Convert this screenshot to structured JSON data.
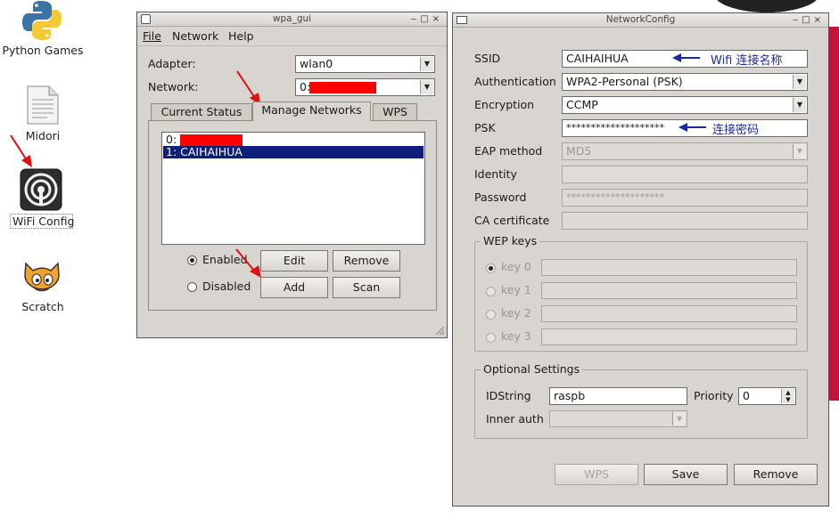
{
  "desktop": {
    "icons": [
      {
        "label": "Python Games",
        "icon": "python-icon"
      },
      {
        "label": "Midori",
        "icon": "document-icon"
      },
      {
        "label": "WiFi Config",
        "icon": "wifi-icon"
      },
      {
        "label": "Scratch",
        "icon": "scratch-cat-icon"
      }
    ]
  },
  "wpa_gui": {
    "title": "wpa_gui",
    "menu": [
      "File",
      "Network",
      "Help"
    ],
    "adapter_label": "Adapter:",
    "adapter_value": "wlan0",
    "network_label": "Network:",
    "network_value": "0:",
    "tabs": [
      "Current Status",
      "Manage Networks",
      "WPS"
    ],
    "networks": [
      "0:",
      "1: CAIHAIHUA"
    ],
    "enabled_label": "Enabled",
    "disabled_label": "Disabled",
    "edit_label": "Edit",
    "remove_label": "Remove",
    "add_label": "Add",
    "scan_label": "Scan"
  },
  "netconfig": {
    "title": "NetworkConfig",
    "ssid_label": "SSID",
    "ssid_value": "CAIHAIHUA",
    "ssid_note": "Wifi 连接名称",
    "auth_label": "Authentication",
    "auth_value": "WPA2-Personal (PSK)",
    "enc_label": "Encryption",
    "enc_value": "CCMP",
    "psk_label": "PSK",
    "psk_value": "********************",
    "psk_note": "连接密码",
    "eap_label": "EAP method",
    "eap_value": "MD5",
    "identity_label": "Identity",
    "password_label": "Password",
    "password_value": "********************",
    "ca_label": "CA certificate",
    "wep_title": "WEP keys",
    "wep_keys": [
      "key 0",
      "key 1",
      "key 2",
      "key 3"
    ],
    "opt_title": "Optional Settings",
    "idstring_label": "IDString",
    "idstring_value": "raspb",
    "priority_label": "Priority",
    "priority_value": "0",
    "inner_auth_label": "Inner auth",
    "wps_label": "WPS",
    "save_label": "Save",
    "remove_label": "Remove"
  },
  "colors": {
    "redaction": "#ff0000",
    "selection": "#0e1e7a",
    "note_blue": "#1b2a9e"
  }
}
